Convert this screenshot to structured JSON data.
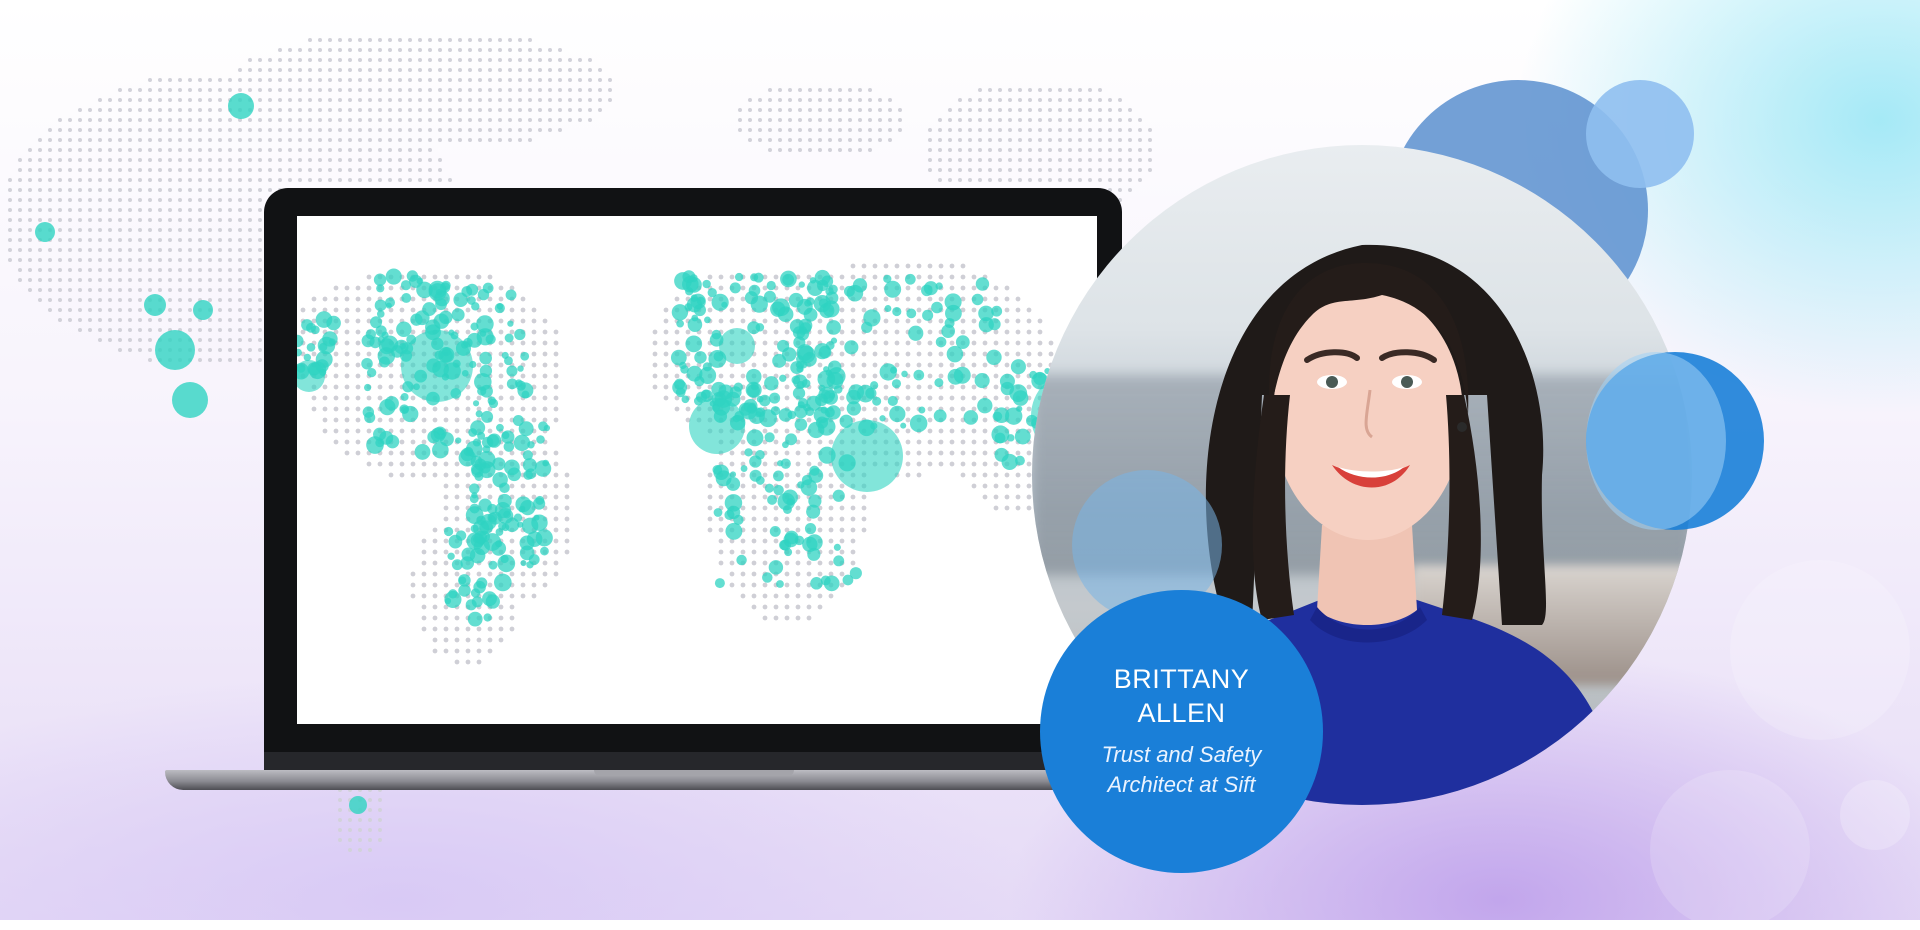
{
  "profile": {
    "name_line1": "BRITTANY",
    "name_line2": "ALLEN",
    "role_line1": "Trust and Safety",
    "role_line2": "Architect at Sift"
  },
  "colors": {
    "brand_blue": "#1a7fd8",
    "map_teal": "#2fd3c2",
    "map_dots": "#cfcfd6",
    "laptop_bezel": "#111214"
  },
  "icons": [
    "world-map-graphic",
    "laptop-graphic",
    "person-photo"
  ]
}
